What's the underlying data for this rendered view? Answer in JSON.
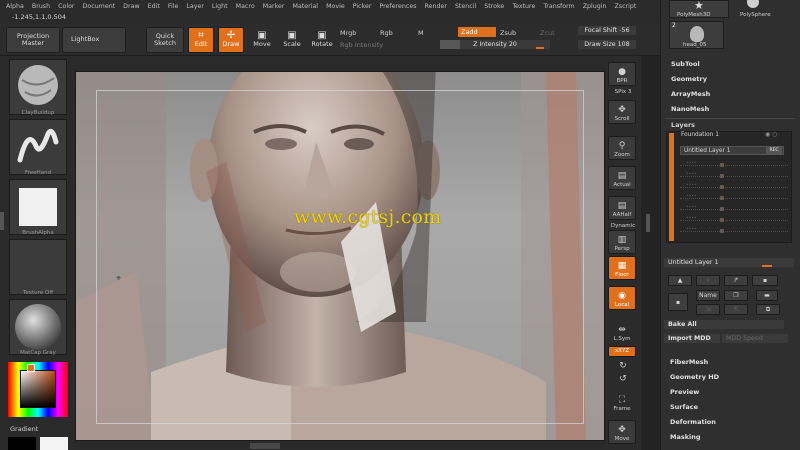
{
  "menu": [
    "Alpha",
    "Brush",
    "Color",
    "Document",
    "Draw",
    "Edit",
    "File",
    "Layer",
    "Light",
    "Macro",
    "Marker",
    "Material",
    "Movie",
    "Picker",
    "Preferences",
    "Render",
    "Stencil",
    "Stroke",
    "Texture",
    "Transform",
    "Zplugin",
    "Zscript"
  ],
  "coords": "-1.245,1.1,0.504",
  "toolbar": {
    "projection_master": "Projection Master",
    "lightbox": "LightBox",
    "quick_sketch": "Quick Sketch",
    "edit": "Edit",
    "draw": "Draw",
    "move": "Move",
    "scale": "Scale",
    "rotate": "Rotate",
    "mrgb": "Mrgb",
    "rgb": "Rgb",
    "m": "M",
    "rgb_intensity": "Rgb Intensity",
    "zadd": "Zadd",
    "zsub": "Zsub",
    "zcut": "Zcut",
    "z_intensity": "Z Intensity 20",
    "focal_shift": "Focal Shift -56",
    "draw_size": "Draw Size 108"
  },
  "left": {
    "brush": "ClayBuildup",
    "stroke": "FreeHand",
    "alpha": "BrushAlpha",
    "texture": "Texture Off",
    "material": "MatCap Gray",
    "gradient": "Gradient"
  },
  "canvas": {
    "watermark": "www.cgtsj.com"
  },
  "shelf": {
    "bpr": "BPR",
    "spix": "SPix 3",
    "scroll": "Scroll",
    "zoom": "Zoom",
    "actual": "Actual",
    "aahalf": "AAHalf",
    "dynamic": "Dynamic",
    "persp": "Persp",
    "floor": "Floor",
    "local": "Local",
    "lsym": "L.Sym",
    "xyz": "xXYZ",
    "frame": "Frame",
    "move": "Move"
  },
  "palette": {
    "thumb1": "PolyMesh3D",
    "thumb2": "PolySphere",
    "thumb3": "head_05",
    "thumb3_count": "2",
    "subtool": "SubTool",
    "geometry": "Geometry",
    "arraymesh": "ArrayMesh",
    "nanomesh": "NanoMesh",
    "layers": "Layers",
    "foundation": "Foundation 1",
    "untitled_row": "Untitled Layer 1",
    "rec": "REC",
    "untitled_bar": "Untitled Layer 1",
    "name_btn": "Name",
    "bake_all": "Bake All",
    "import_mdd": "Import MDD",
    "mdd_speed": "MDD Speed",
    "fibermesh": "FiberMesh",
    "geometry_hd": "Geometry HD",
    "preview": "Preview",
    "surface": "Surface",
    "deformation": "Deformation",
    "masking": "Masking"
  },
  "colors": {
    "accent": "#e0701b",
    "watermark": "#f2d200"
  }
}
